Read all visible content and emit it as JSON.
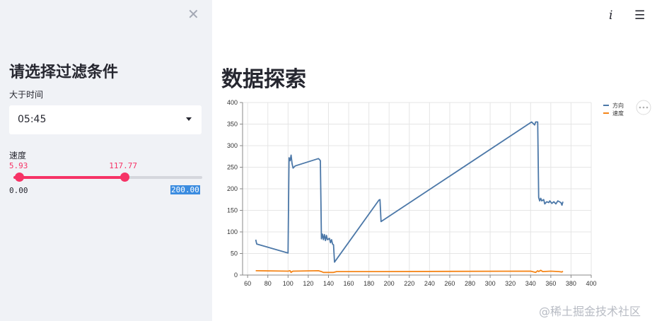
{
  "sidebar": {
    "title": "请选择过滤条件",
    "time_filter": {
      "label": "大于时间",
      "value": "05:45"
    },
    "speed_filter": {
      "label": "速度",
      "min": 0.0,
      "max": 200.0,
      "low": 5.93,
      "high": 117.77,
      "low_label": "5.93",
      "high_label": "117.77",
      "min_label": "0.00",
      "max_label": "200.00"
    }
  },
  "main": {
    "title": "数据探索"
  },
  "icons": {
    "close": "close-icon",
    "info": "info-icon",
    "menu": "hamburger-menu-icon",
    "chart_menu": "more-horizontal-icon"
  },
  "watermark": "@稀土掘金技术社区",
  "colors": {
    "accent": "#f63366",
    "series_direction": "#4c78a8",
    "series_speed": "#f58518"
  },
  "chart_data": {
    "type": "line",
    "xlim": [
      55,
      400
    ],
    "ylim": [
      0,
      400
    ],
    "x_ticks": [
      60,
      80,
      100,
      120,
      140,
      160,
      180,
      200,
      220,
      240,
      260,
      280,
      300,
      320,
      340,
      360,
      380,
      400
    ],
    "y_ticks": [
      0,
      50,
      100,
      150,
      200,
      250,
      300,
      350,
      400
    ],
    "grid": true,
    "legend_position": "top-right",
    "series": [
      {
        "name": "方向",
        "color": "#4c78a8",
        "points": [
          [
            68,
            82
          ],
          [
            69,
            72
          ],
          [
            100,
            51
          ],
          [
            101,
            272
          ],
          [
            102,
            265
          ],
          [
            103,
            278
          ],
          [
            104,
            258
          ],
          [
            105,
            248
          ],
          [
            107,
            253
          ],
          [
            130,
            270
          ],
          [
            131,
            268
          ],
          [
            132,
            265
          ],
          [
            133,
            84
          ],
          [
            134,
            95
          ],
          [
            135,
            82
          ],
          [
            136,
            94
          ],
          [
            137,
            80
          ],
          [
            138,
            92
          ],
          [
            139,
            82
          ],
          [
            141,
            85
          ],
          [
            142,
            75
          ],
          [
            143,
            82
          ],
          [
            144,
            72
          ],
          [
            145,
            70
          ],
          [
            146,
            30
          ],
          [
            190,
            174
          ],
          [
            191,
            175
          ],
          [
            192,
            124
          ],
          [
            341,
            355
          ],
          [
            344,
            348
          ],
          [
            345,
            355
          ],
          [
            347,
            355
          ],
          [
            348,
            180
          ],
          [
            349,
            172
          ],
          [
            350,
            178
          ],
          [
            351,
            172
          ],
          [
            353,
            175
          ],
          [
            354,
            165
          ],
          [
            356,
            170
          ],
          [
            358,
            168
          ],
          [
            359,
            172
          ],
          [
            361,
            166
          ],
          [
            363,
            170
          ],
          [
            365,
            165
          ],
          [
            367,
            172
          ],
          [
            370,
            168
          ],
          [
            371,
            162
          ],
          [
            372,
            170
          ]
        ]
      },
      {
        "name": "速度",
        "color": "#f58518",
        "points": [
          [
            68,
            10
          ],
          [
            100,
            9
          ],
          [
            102,
            10
          ],
          [
            103,
            6
          ],
          [
            104,
            8
          ],
          [
            105,
            9
          ],
          [
            130,
            10
          ],
          [
            133,
            8
          ],
          [
            135,
            6
          ],
          [
            145,
            6
          ],
          [
            148,
            8
          ],
          [
            190,
            8
          ],
          [
            340,
            9
          ],
          [
            345,
            6
          ],
          [
            347,
            10
          ],
          [
            348,
            8
          ],
          [
            350,
            11
          ],
          [
            352,
            8
          ],
          [
            360,
            9
          ],
          [
            368,
            8
          ],
          [
            371,
            7
          ],
          [
            372,
            9
          ]
        ]
      }
    ]
  }
}
